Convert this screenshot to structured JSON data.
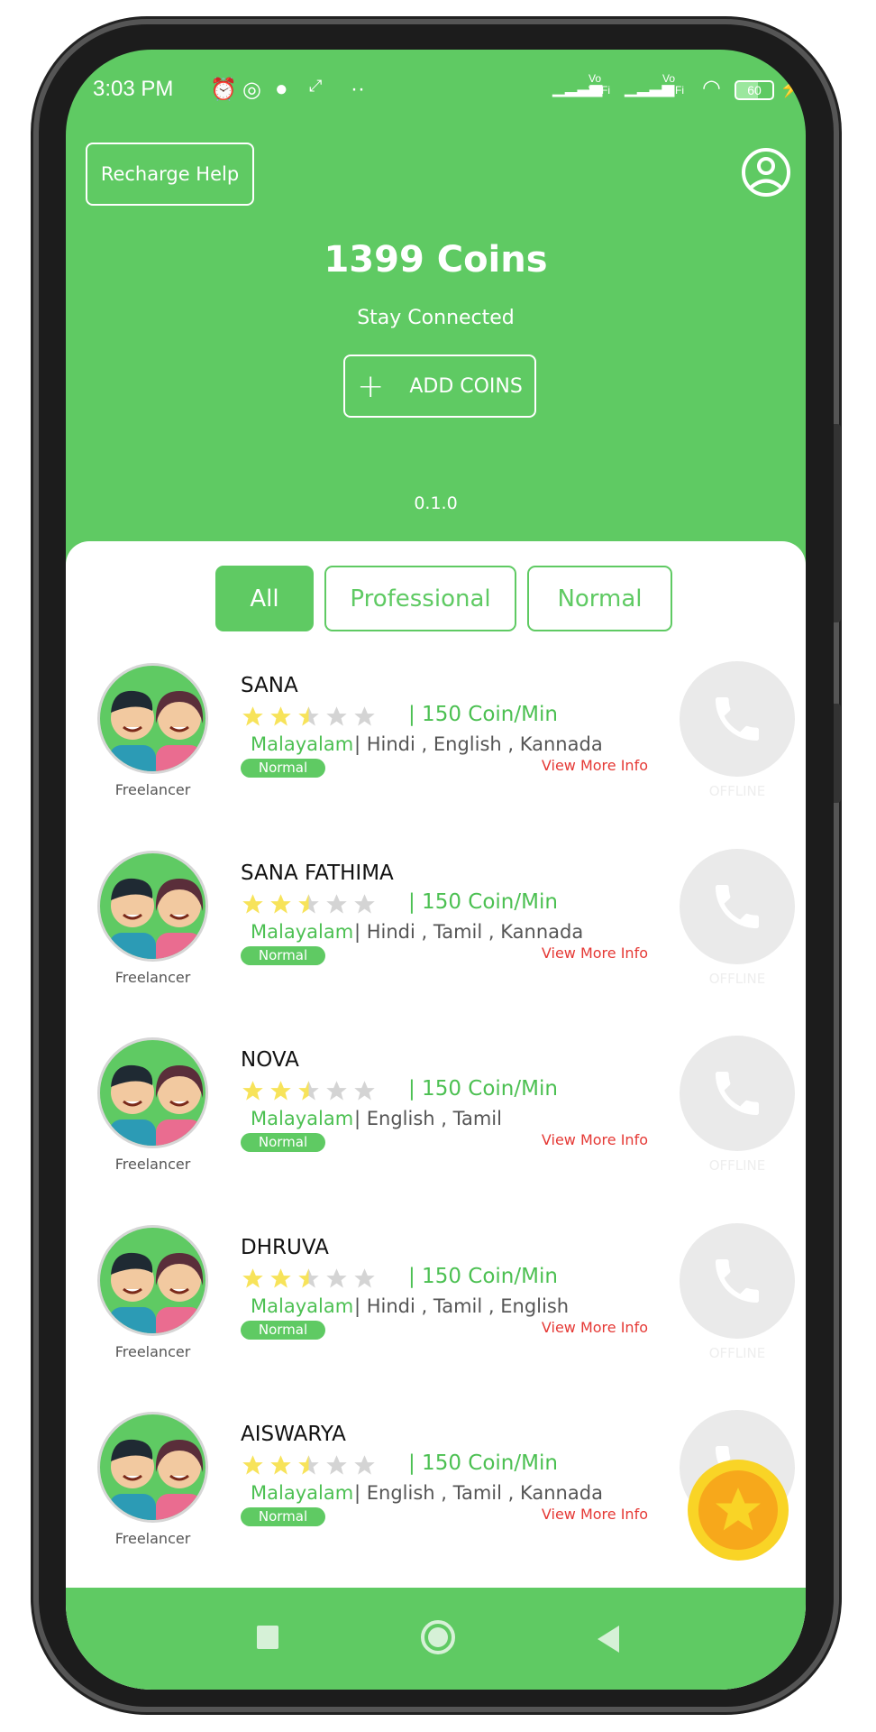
{
  "status_bar": {
    "time": "3:03 PM",
    "battery": "60",
    "network_labels": [
      "Vo WiFi",
      "Vo WiFi"
    ]
  },
  "header": {
    "recharge_help": "Recharge Help",
    "coins": "1399 Coins",
    "subtitle": "Stay Connected",
    "add_coins": "ADD COINS",
    "version": "0.1.0"
  },
  "tabs": [
    {
      "label": "All",
      "active": true
    },
    {
      "label": "Professional",
      "active": false
    },
    {
      "label": "Normal",
      "active": false
    }
  ],
  "colors": {
    "brand": "#5fca63",
    "link": "#e53935",
    "star": "#f7e35a",
    "fab": "#f5c518"
  },
  "listeners": [
    {
      "name": "SANA",
      "rating": 2.5,
      "rate": "| 150 Coin/Min",
      "primary_language": "Malayalam",
      "languages": "| Hindi , English , Kannada",
      "badge": "Normal",
      "more": "View More Info",
      "role": "Freelancer",
      "status": "OFFLINE"
    },
    {
      "name": "SANA FATHIMA",
      "rating": 2.5,
      "rate": "| 150 Coin/Min",
      "primary_language": "Malayalam",
      "languages": "| Hindi , Tamil , Kannada",
      "badge": "Normal",
      "more": "View More Info",
      "role": "Freelancer",
      "status": "OFFLINE"
    },
    {
      "name": "NOVA",
      "rating": 2.5,
      "rate": "| 150 Coin/Min",
      "primary_language": "Malayalam",
      "languages": "| English , Tamil",
      "badge": "Normal",
      "more": "View More Info",
      "role": "Freelancer",
      "status": "OFFLINE"
    },
    {
      "name": "DHRUVA",
      "rating": 2.5,
      "rate": "| 150 Coin/Min",
      "primary_language": "Malayalam",
      "languages": "| Hindi , Tamil , English",
      "badge": "Normal",
      "more": "View More Info",
      "role": "Freelancer",
      "status": "OFFLINE"
    },
    {
      "name": "AISWARYA",
      "rating": 2.5,
      "rate": "| 150 Coin/Min",
      "primary_language": "Malayalam",
      "languages": "| English , Tamil , Kannada",
      "badge": "Normal",
      "more": "View More Info",
      "role": "Freelancer",
      "status": "OFFLINE"
    }
  ]
}
